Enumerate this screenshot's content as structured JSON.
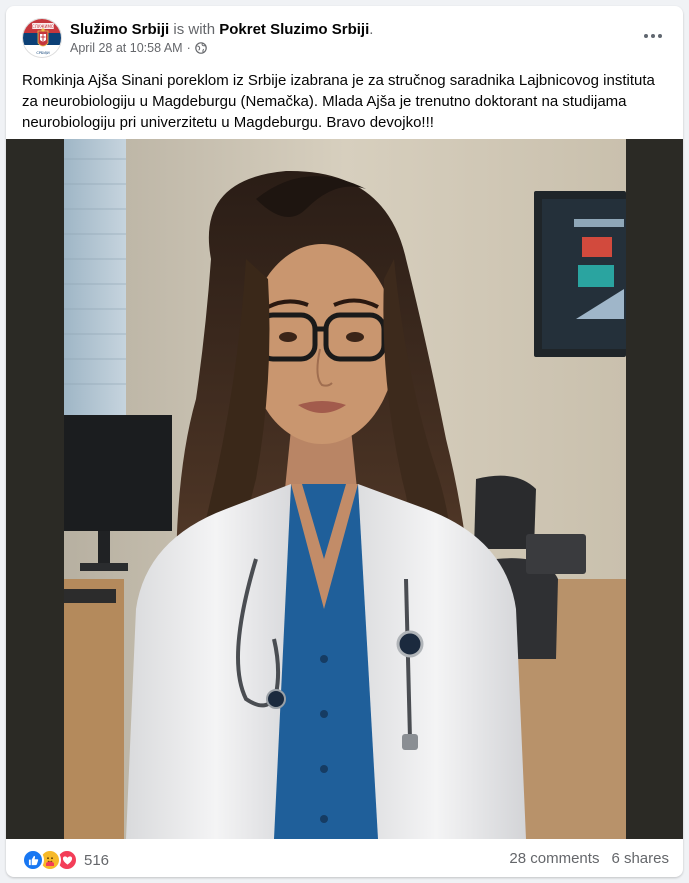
{
  "post": {
    "author": "Služimo Srbiji",
    "with_text": "is with",
    "tagged_page": "Pokret Sluzimo Srbiji",
    "period": ".",
    "timestamp": "April 28 at 10:58 AM",
    "separator": "·",
    "audience_icon": "globe-icon",
    "body": "Romkinja Ajša Sinani poreklom iz Srbije izabrana je za stručnog saradnika Lajbnicovog instituta za neurobiologiju u Magdeburgu (Nemačka). Mlada Ajša je trenutno doktorant na studijama neurobiologiju pri univerzitetu u Magdeburgu. Bravo devojko!!!"
  },
  "avatar": {
    "badge_text": "СЛУЖИМО",
    "badge_subtext": "СРБИЈИ"
  },
  "engagement": {
    "reactions": [
      "like",
      "care",
      "love"
    ],
    "reaction_count": "516",
    "comments": "28 comments",
    "shares": "6 shares"
  },
  "colors": {
    "like": "#1877f2",
    "care": "#f7b928",
    "love": "#f33e58",
    "muted_text": "#65676b",
    "media_bg": "#2b2a25"
  }
}
